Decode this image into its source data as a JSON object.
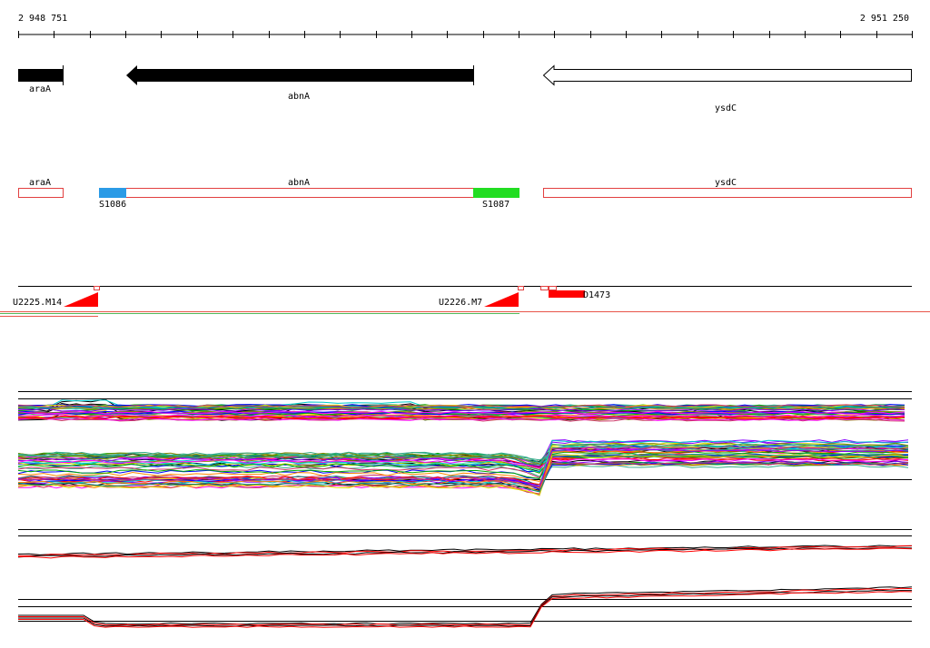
{
  "ruler": {
    "start_label": "2 948 751",
    "end_label": "2 951 250"
  },
  "genes": [
    {
      "name": "araA",
      "strand": "forward"
    },
    {
      "name": "abnA",
      "strand": "reverse"
    },
    {
      "name": "ysdC",
      "strand": "reverse"
    }
  ],
  "transcripts": [
    {
      "name": "araA"
    },
    {
      "name": "abnA"
    },
    {
      "name": "ysdC"
    }
  ],
  "segments": [
    {
      "label": "S1086",
      "color": "#2b9be6"
    },
    {
      "label": "S1087",
      "color": "#22dd22"
    }
  ],
  "features": [
    {
      "label": "U2225.M14"
    },
    {
      "label": "U2226.M7"
    },
    {
      "label": "D1473",
      "color": "#ff0000"
    }
  ],
  "colors": {
    "axis": "#000000",
    "gene_fill": "#000000",
    "gene_outline": "#000000",
    "transcript_outline": "#e24040",
    "feature_red": "#ff0000",
    "baseline_red": "#e8554a",
    "baseline_green": "#53b85a"
  },
  "track_palette": [
    "#ff0000",
    "#00aa00",
    "#0000ff",
    "#ff00ff",
    "#00cccc",
    "#dddd00",
    "#ff8800",
    "#8800ff",
    "#008888",
    "#888800",
    "#cc3366",
    "#33aa88"
  ]
}
